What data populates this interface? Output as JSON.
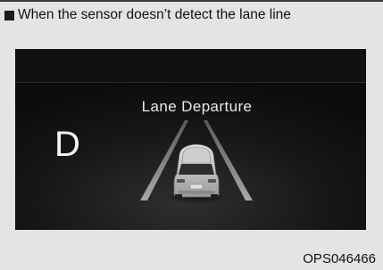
{
  "caption": {
    "text": "When the sensor doesn’t detect the lane line"
  },
  "display": {
    "gear": "D",
    "warning": "Lane Departure"
  },
  "figure_code": "OPS046466",
  "colors": {
    "panel_bg": "#e4e4e4",
    "display_bg": "#111213",
    "lane_line": "#8c8c8c",
    "text": "#e9e9e9"
  }
}
